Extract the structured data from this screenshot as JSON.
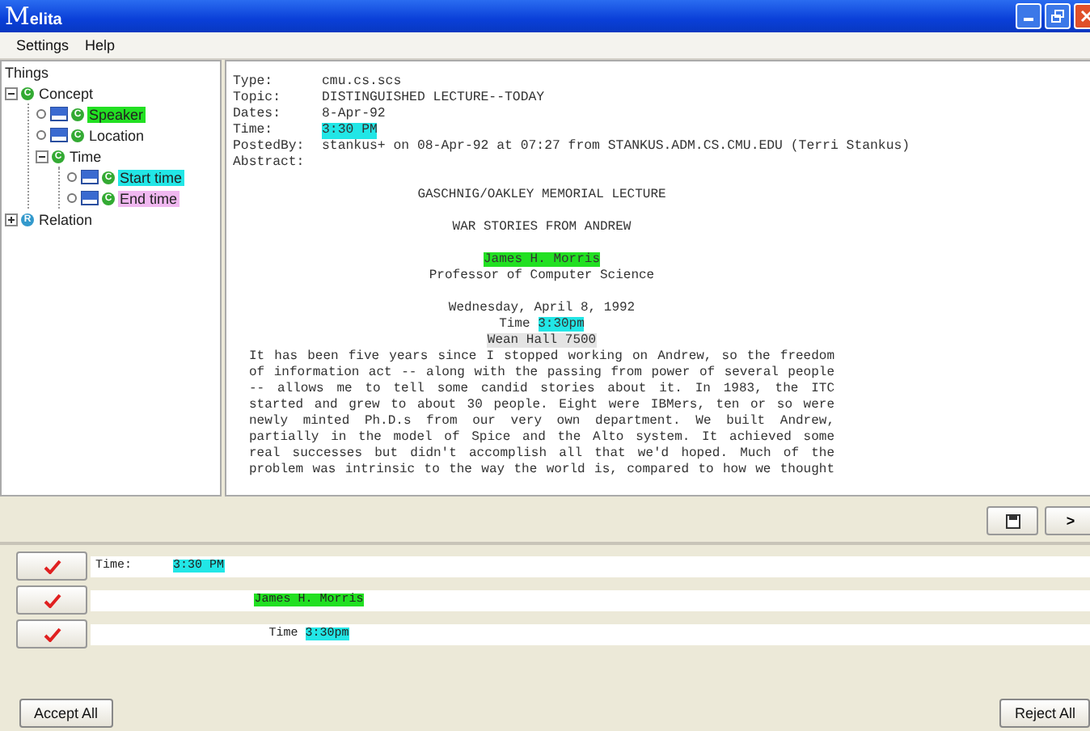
{
  "window": {
    "title": "Melita"
  },
  "menu": [
    "Settings",
    "Help"
  ],
  "tree": {
    "root": "Things",
    "items": [
      {
        "label": "Concept",
        "badge": "C",
        "expanded": true,
        "children": [
          {
            "label": "Speaker",
            "badge": "C",
            "color": "#22e022"
          },
          {
            "label": "Location",
            "badge": "C"
          },
          {
            "label": "Time",
            "badge": "C",
            "expanded": true,
            "children": [
              {
                "label": "Start time",
                "badge": "C",
                "color": "#22e6e6"
              },
              {
                "label": "End time",
                "badge": "C",
                "color": "#f0b8f0"
              }
            ]
          }
        ]
      },
      {
        "label": "Relation",
        "badge": "R",
        "expanded": false
      }
    ]
  },
  "document": {
    "fields": [
      {
        "label": "Type:",
        "value": "cmu.cs.scs"
      },
      {
        "label": "Topic:",
        "value": "DISTINGUISHED LECTURE--TODAY"
      },
      {
        "label": "Dates:",
        "value": "8-Apr-92"
      },
      {
        "label": "Time:",
        "value": "3:30 PM",
        "color": "#22e6e6"
      },
      {
        "label": "PostedBy:",
        "value": "stankus+ on 08-Apr-92 at 07:27 from STANKUS.ADM.CS.CMU.EDU (Terri Stankus)"
      },
      {
        "label": "Abstract:"
      }
    ],
    "blocks": [
      {
        "lines": [
          {
            "kind": "centered",
            "segments": [
              {
                "text": "GASCHNIG/OAKLEY MEMORIAL LECTURE"
              }
            ]
          }
        ]
      },
      {
        "lines": [
          {
            "kind": "centered",
            "segments": [
              {
                "text": "WAR STORIES FROM ANDREW"
              }
            ]
          }
        ]
      },
      {
        "lines": [
          {
            "kind": "centered",
            "segments": [
              {
                "text": "James H. Morris",
                "color": "#22e022"
              }
            ]
          },
          {
            "kind": "centered",
            "segments": [
              {
                "text": "Professor of Computer Science"
              }
            ]
          }
        ]
      },
      {
        "lines": [
          {
            "kind": "centered",
            "segments": [
              {
                "text": "Wednesday, April 8, 1992"
              }
            ]
          },
          {
            "kind": "centered",
            "segments": [
              {
                "text": "Time "
              },
              {
                "text": "3:30pm",
                "color": "#22e6e6"
              }
            ]
          },
          {
            "kind": "centered",
            "segments": [
              {
                "text": "Wean Hall 7500",
                "color": "#e4e4e4"
              }
            ]
          },
          {
            "kind": "paragraph",
            "segments": [
              {
                "text": "It has been five years since I stopped working on Andrew, so the freedom"
              }
            ]
          },
          {
            "kind": "paragraph",
            "segments": [
              {
                "text": "of information act -- along with the passing from power of several people"
              }
            ]
          },
          {
            "kind": "paragraph",
            "segments": [
              {
                "text": "-- allows me to tell some candid stories about it. In 1983, the ITC"
              }
            ]
          },
          {
            "kind": "paragraph",
            "segments": [
              {
                "text": "started and grew to about 30 people. Eight were IBMers, ten or so were"
              }
            ]
          },
          {
            "kind": "paragraph",
            "segments": [
              {
                "text": "newly minted Ph.D.s from our very own department. We built Andrew,"
              }
            ]
          },
          {
            "kind": "paragraph",
            "segments": [
              {
                "text": "partially in the model of Spice and the Alto system. It achieved some"
              }
            ]
          },
          {
            "kind": "paragraph",
            "segments": [
              {
                "text": "real successes but didn't accomplish all that we'd hoped. Much of the"
              }
            ]
          },
          {
            "kind": "paragraph",
            "segments": [
              {
                "text": "problem was intrinsic to the way the world is, compared to how we thought"
              }
            ]
          }
        ]
      }
    ]
  },
  "toolbar": {
    "next_label": ">"
  },
  "matches": [
    {
      "kind": "field",
      "segments": [
        {
          "text": "Time:"
        },
        {
          "text": "3:30 PM",
          "color": "#22e6e6"
        }
      ]
    },
    {
      "kind": "context",
      "segments": [
        {
          "text": "James H. Morris",
          "color": "#22e022"
        }
      ]
    },
    {
      "kind": "context",
      "segments": [
        {
          "text": "Time "
        },
        {
          "text": "3:30pm",
          "color": "#22e6e6"
        }
      ]
    }
  ],
  "buttons": {
    "accept": "Accept All",
    "reject": "Reject All"
  }
}
